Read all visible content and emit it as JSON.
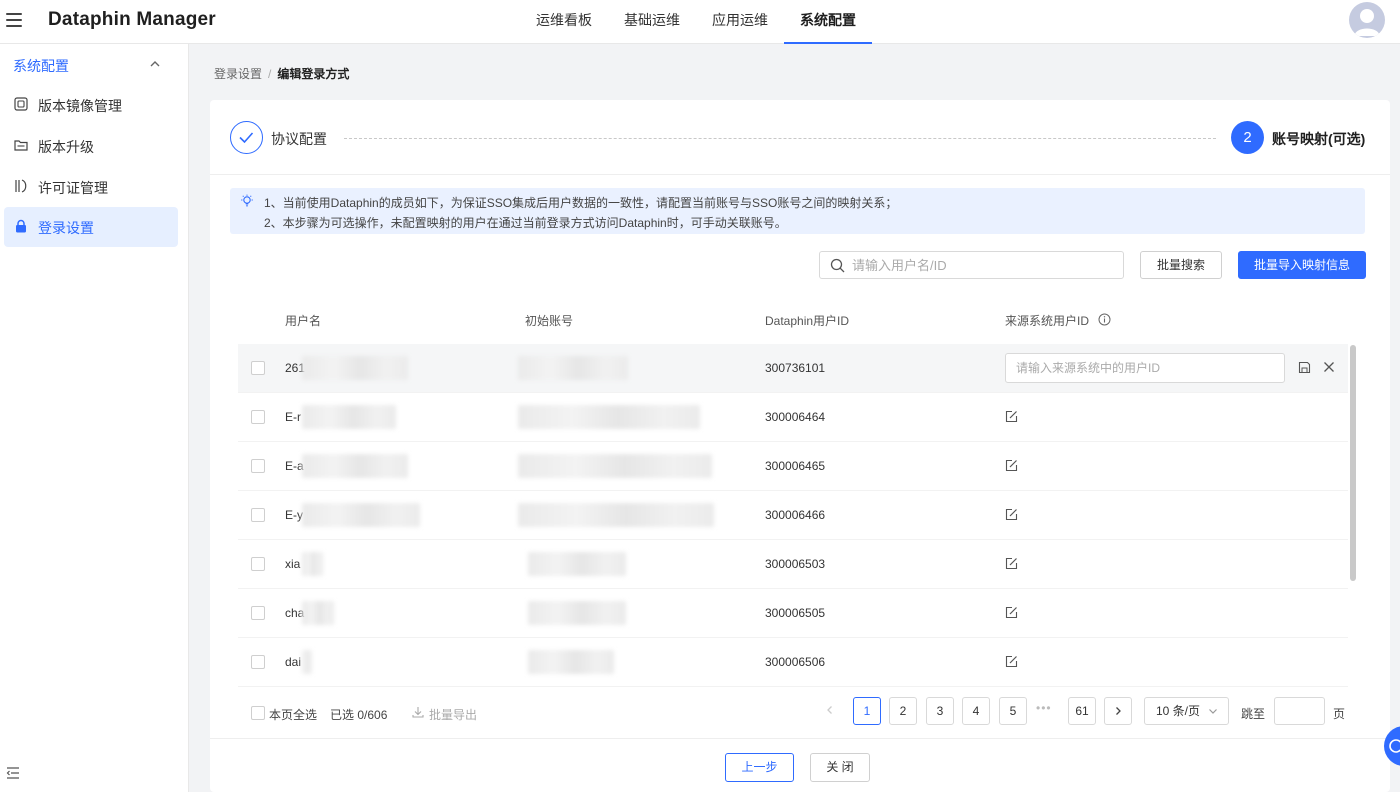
{
  "app": {
    "brand": "Dataphin Manager"
  },
  "nav": [
    {
      "label": "运维看板",
      "active": false
    },
    {
      "label": "基础运维",
      "active": false
    },
    {
      "label": "应用运维",
      "active": false
    },
    {
      "label": "系统配置",
      "active": true
    }
  ],
  "sidebar": {
    "group_label": "系统配置",
    "items": [
      {
        "label": "版本镜像管理",
        "icon": "image-icon"
      },
      {
        "label": "版本升级",
        "icon": "folder-icon"
      },
      {
        "label": "许可证管理",
        "icon": "license-icon"
      },
      {
        "label": "登录设置",
        "icon": "lock-icon",
        "active": true
      }
    ]
  },
  "breadcrumb": {
    "parent": "登录设置",
    "separator": "/",
    "current": "编辑登录方式"
  },
  "steps": [
    {
      "label": "协议配置",
      "status": "done"
    },
    {
      "number": "2",
      "label": "账号映射(可选)",
      "status": "active"
    }
  ],
  "info": {
    "line1": "1、当前使用Dataphin的成员如下，为保证SSO集成后用户数据的一致性，请配置当前账号与SSO账号之间的映射关系；",
    "line2": "2、本步骤为可选操作，未配置映射的用户在通过当前登录方式访问Dataphin时，可手动关联账号。"
  },
  "toolbar": {
    "search_placeholder": "请输入用户名/ID",
    "batch_search": "批量搜索",
    "batch_import": "批量导入映射信息"
  },
  "table": {
    "headers": [
      "用户名",
      "初始账号",
      "Dataphin用户ID",
      "来源系统用户ID"
    ],
    "rows": [
      {
        "username": "261",
        "dataphin_id": "300736101",
        "editing": true
      },
      {
        "username": "E-r",
        "dataphin_id": "300006464"
      },
      {
        "username": "E-a",
        "dataphin_id": "300006465"
      },
      {
        "username": "E-y",
        "dataphin_id": "300006466"
      },
      {
        "username": "xia",
        "dataphin_id": "300006503"
      },
      {
        "username": "cha",
        "dataphin_id": "300006505"
      },
      {
        "username": "dai",
        "dataphin_id": "300006506"
      }
    ],
    "source_id_placeholder": "请输入来源系统中的用户ID"
  },
  "footer": {
    "select_page": "本页全选",
    "selected": "已选 0/606",
    "batch_export": "批量导出",
    "pages": [
      "1",
      "2",
      "3",
      "4",
      "5"
    ],
    "ellipsis": "•••",
    "last_page": "61",
    "current_page": 1,
    "page_size": "10 条/页",
    "jump_to": "跳至",
    "page_unit": "页"
  },
  "actions": {
    "prev": "上一步",
    "close": "关 闭"
  },
  "colors": {
    "primary": "#2f6bff",
    "info_bg": "#eaf1ff"
  }
}
